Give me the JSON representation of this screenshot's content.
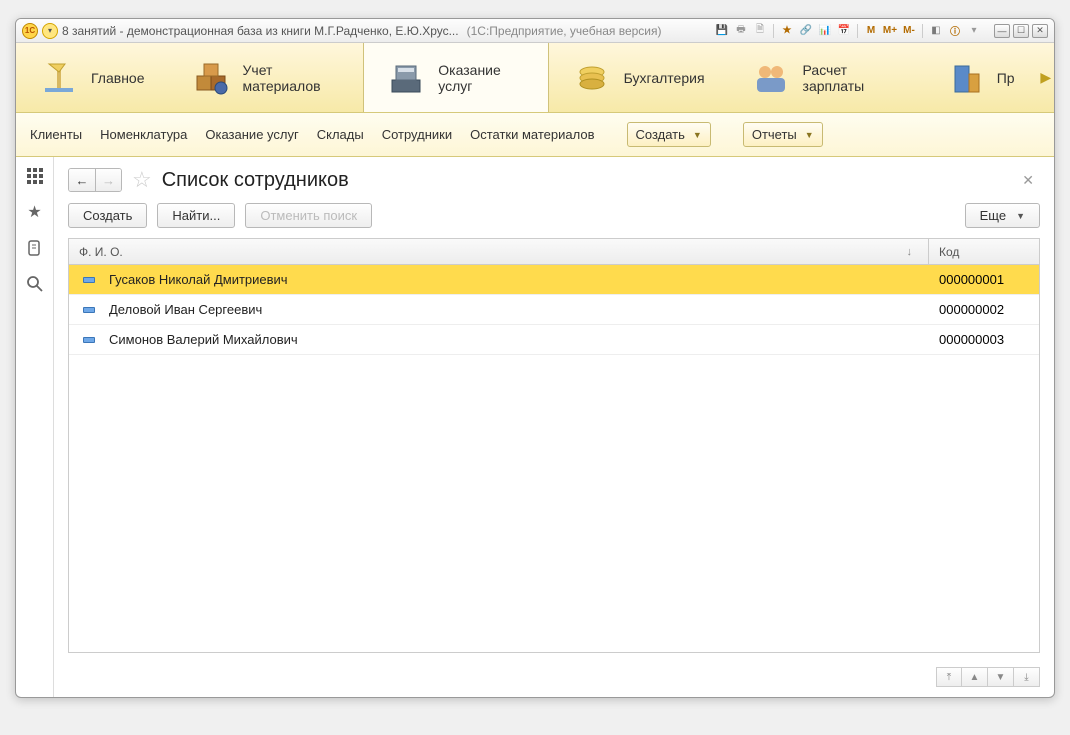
{
  "titlebar": {
    "title": "8 занятий - демонстрационная база из книги М.Г.Радченко, Е.Ю.Хрус...",
    "suffix": "(1С:Предприятие, учебная версия)",
    "tool_m": "M",
    "tool_mp": "M+",
    "tool_mm": "M-"
  },
  "sections": {
    "s1": "Главное",
    "s2": "Учет материалов",
    "s3": "Оказание услуг",
    "s4": "Бухгалтерия",
    "s5": "Расчет зарплаты",
    "s6": "Пр"
  },
  "menu": {
    "m1": "Клиенты",
    "m2": "Номенклатура",
    "m3": "Оказание услуг",
    "m4": "Склады",
    "m5": "Сотрудники",
    "m6": "Остатки материалов",
    "create": "Создать",
    "reports": "Отчеты"
  },
  "page": {
    "title": "Список сотрудников",
    "btn_create": "Создать",
    "btn_find": "Найти...",
    "btn_cancel_find": "Отменить поиск",
    "btn_more": "Еще"
  },
  "table": {
    "header_name": "Ф. И. О.",
    "header_code": "Код",
    "rows": [
      {
        "name": "Гусаков Николай Дмитриевич",
        "code": "000000001",
        "selected": true
      },
      {
        "name": "Деловой Иван Сергеевич",
        "code": "000000002",
        "selected": false
      },
      {
        "name": "Симонов Валерий Михайлович",
        "code": "000000003",
        "selected": false
      }
    ]
  }
}
